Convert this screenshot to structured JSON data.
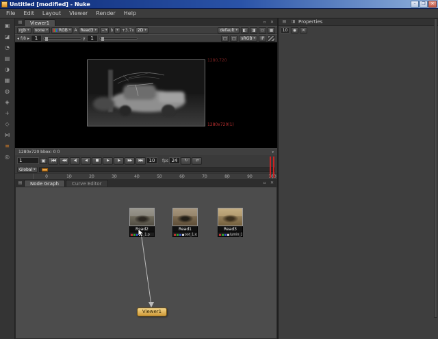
{
  "colors": {
    "titlebar_blue": "#0d2a75",
    "accent_orange": "#d89a3c",
    "playhead_red": "#cc2424",
    "label_red_dim": "#7c2222",
    "label_red": "#c23232"
  },
  "icons": {
    "panel_menu": "▤",
    "float_panel": "▫",
    "close_x": "✕",
    "arrow_down": "▾",
    "arrow_left": "◂",
    "arrow_right": "▸",
    "lock": "▣",
    "loop": "↻",
    "bounce": "⇄",
    "wipe_a": "◧",
    "wipe_b": "◨",
    "roi": "▭",
    "checker": "▦",
    "gamma_box": "□",
    "pin": "◉",
    "prop_list": "▤",
    "prop_grid": "◨"
  },
  "titlebar": {
    "title": "Untitled [modified] - Nuke",
    "minimize": "–",
    "maximize": "❐",
    "close": "✕"
  },
  "menubar": {
    "items": [
      "File",
      "Edit",
      "Layout",
      "Viewer",
      "Render",
      "Help"
    ]
  },
  "toolbox": {
    "items": [
      {
        "name": "image",
        "glyph": "▣"
      },
      {
        "name": "draw",
        "glyph": "◪"
      },
      {
        "name": "time",
        "glyph": "◔"
      },
      {
        "name": "channel",
        "glyph": "▤"
      },
      {
        "name": "color",
        "glyph": "◑"
      },
      {
        "name": "filter",
        "glyph": "▦"
      },
      {
        "name": "keyer",
        "glyph": "◍"
      },
      {
        "name": "merge",
        "glyph": "◈"
      },
      {
        "name": "transform",
        "glyph": "+"
      },
      {
        "name": "3d",
        "glyph": "◇"
      },
      {
        "name": "particles",
        "glyph": "⋈"
      },
      {
        "name": "metadata",
        "glyph": "≡"
      },
      {
        "name": "other",
        "glyph": "◎"
      }
    ]
  },
  "viewer_panel": {
    "tab": "Viewer1",
    "row1": {
      "layer": "rgb",
      "matte": "none",
      "channels": "RGB",
      "a_label": "A",
      "a_input": "Read3",
      "wipe_mode": "–",
      "b_label": "b",
      "zoom": "+3.7x",
      "view": "2D",
      "process": "default"
    },
    "row2": {
      "fstop": "f/8",
      "gain": "1",
      "gamma_symbol": "γ",
      "gamma": "1",
      "colorspace": "sRGB",
      "ip": "IP"
    },
    "canvas": {
      "res_topright": "1280,720",
      "res_bottomright": "1280x720(1)"
    },
    "status": "1280x720  bbox: 0 0",
    "transport": {
      "frame": "1",
      "buttons": [
        "|◀◀",
        "◀◀",
        "◀|",
        "◀",
        "■",
        "▶",
        "|▶",
        "▶▶",
        "▶▶|"
      ],
      "increment": "10",
      "fps_label": "fps",
      "fps": "24"
    },
    "range_label": "Global",
    "ruler_ticks": [
      "0",
      "10",
      "20",
      "30",
      "40",
      "50",
      "60",
      "70",
      "80",
      "90",
      "100"
    ]
  },
  "nodegraph": {
    "tabs": [
      {
        "label": "Node Graph"
      },
      {
        "label": "Curve Editor"
      }
    ],
    "nodes": [
      {
        "name": "Read2",
        "file": "t_1.p"
      },
      {
        "name": "Read1",
        "file": "oot_1.e"
      },
      {
        "name": "Read3",
        "file": "lumin_1"
      }
    ],
    "viewer_node": "Viewer1"
  },
  "properties_panel": {
    "title": "Properties",
    "max_nodes": "10"
  }
}
